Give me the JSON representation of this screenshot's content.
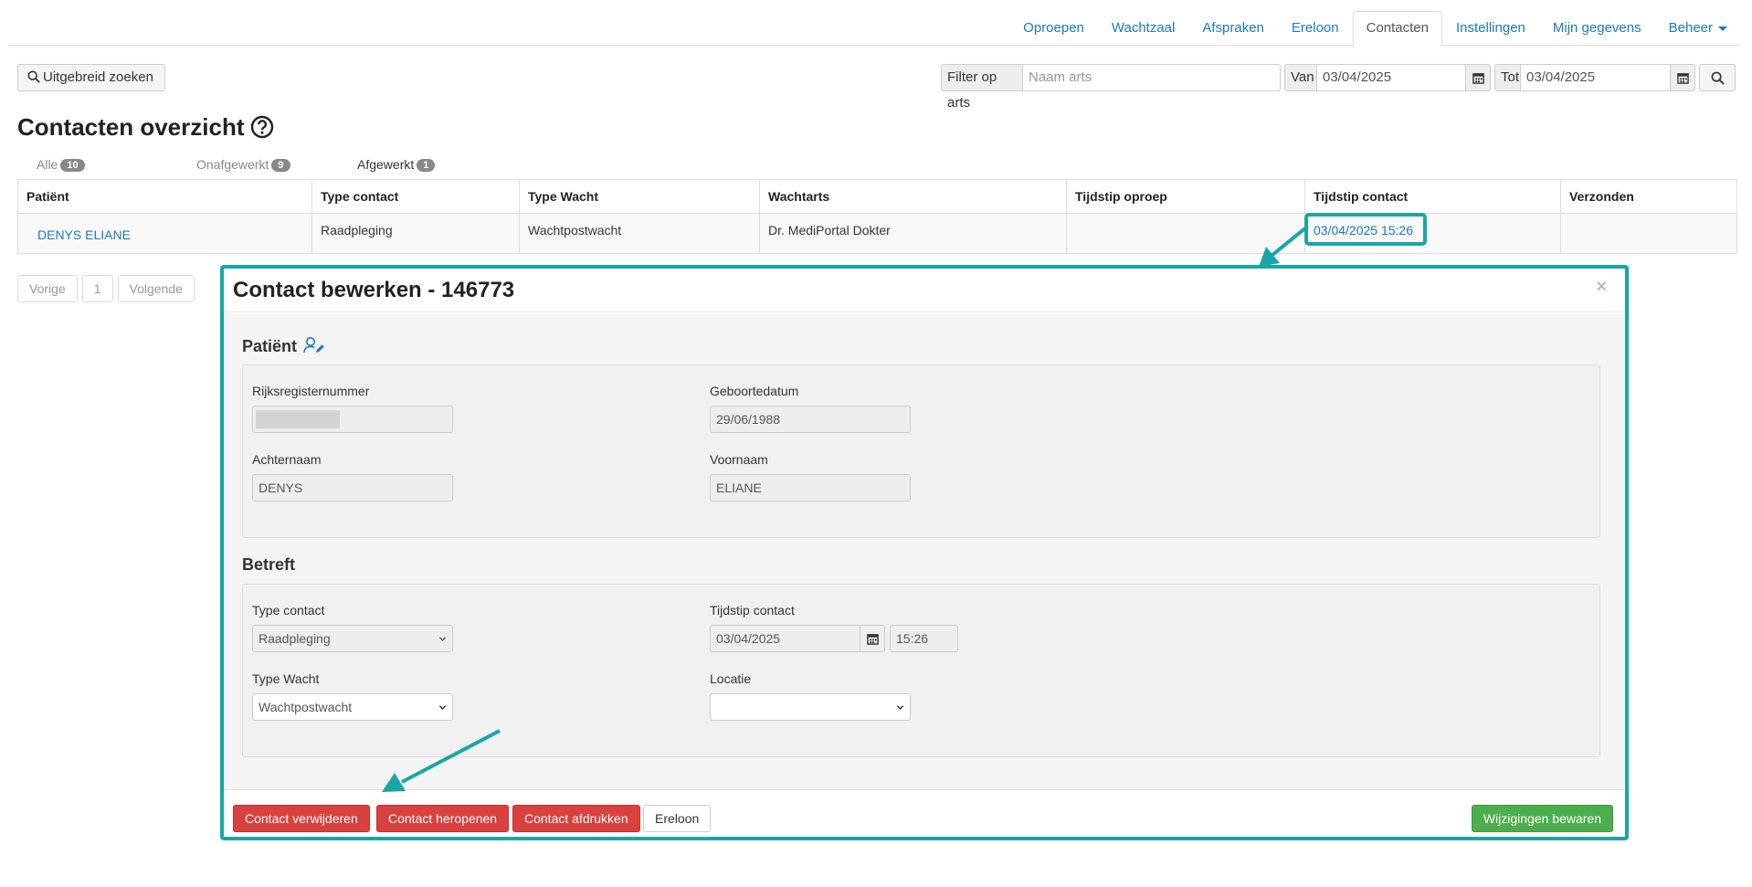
{
  "nav": {
    "tabs": [
      {
        "label": "Oproepen"
      },
      {
        "label": "Wachtzaal"
      },
      {
        "label": "Afspraken"
      },
      {
        "label": "Ereloon"
      },
      {
        "label": "Contacten"
      },
      {
        "label": "Instellingen"
      },
      {
        "label": "Mijn gegevens"
      },
      {
        "label": "Beheer"
      }
    ],
    "active": "Contacten"
  },
  "toolbar": {
    "advanced_search_label": "Uitgebreid zoeken",
    "filter_label": "Filter op arts",
    "doctor_placeholder": "Naam arts",
    "from_label": "Van",
    "from_value": "03/04/2025",
    "to_label": "Tot",
    "to_value": "03/04/2025"
  },
  "page": {
    "title": "Contacten overzicht"
  },
  "filters": [
    {
      "label": "Alle",
      "count": "10"
    },
    {
      "label": "Onafgewerkt",
      "count": "9"
    },
    {
      "label": "Afgewerkt",
      "count": "1"
    }
  ],
  "table": {
    "headers": [
      "Patiënt",
      "Type contact",
      "Type Wacht",
      "Wachtarts",
      "Tijdstip oproep",
      "Tijdstip contact",
      "Verzonden"
    ],
    "rows": [
      {
        "patient": "DENYS ELIANE",
        "type_contact": "Raadpleging",
        "type_wacht": "Wachtpostwacht",
        "wachtarts": "Dr. MediPortal Dokter",
        "tijdstip_oproep": "",
        "tijdstip_contact": "03/04/2025 15:26",
        "verzonden": ""
      }
    ]
  },
  "pager": {
    "prev": "Vorige",
    "page": "1",
    "next": "Volgende"
  },
  "modal": {
    "title": "Contact bewerken - 146773",
    "close": "×",
    "patient_section": "Patiënt",
    "rijksregister_label": "Rijksregisternummer",
    "geboortedatum_label": "Geboortedatum",
    "geboortedatum_value": "29/06/1988",
    "achternaam_label": "Achternaam",
    "achternaam_value": "DENYS",
    "voornaam_label": "Voornaam",
    "voornaam_value": "ELIANE",
    "betreft_section": "Betreft",
    "type_contact_label": "Type contact",
    "type_contact_value": "Raadpleging",
    "tijdstip_label": "Tijdstip contact",
    "tijdstip_date": "03/04/2025",
    "tijdstip_time": "15:26",
    "type_wacht_label": "Type Wacht",
    "type_wacht_value": "Wachtpostwacht",
    "locatie_label": "Locatie",
    "locatie_value": "",
    "buttons": {
      "delete": "Contact verwijderen",
      "reopen": "Contact heropenen",
      "print": "Contact afdrukken",
      "fee": "Ereloon",
      "save": "Wijzigingen bewaren"
    }
  },
  "colors": {
    "accent": "#1aa6a6",
    "link": "#1a7bbf",
    "danger": "#d9413f",
    "success": "#4cae4c"
  }
}
